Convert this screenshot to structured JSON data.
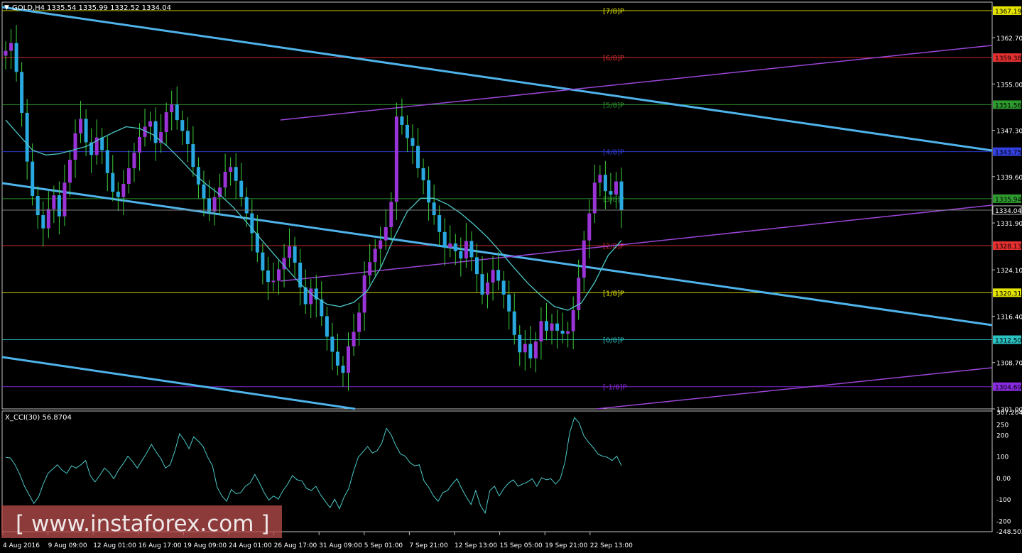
{
  "header": {
    "symbol": "GOLD,H4",
    "ohlc": "1335.54 1335.99 1332.52 1334.04"
  },
  "indicator": {
    "label": "X_CCI(30) 56.8704"
  },
  "watermark": "[ www.instaforex.com ]",
  "colors": {
    "background": "#000000",
    "grid": "#c0c0c0",
    "bull": "#9a34d6",
    "bear": "#2aa9e0",
    "candle_wick": "#3dcf3d",
    "ma": "#4cc7c7",
    "channel": "#4fb3ea",
    "purple_line": "#9b45d8",
    "cci": "#4cc7c7"
  },
  "chart_data": [
    {
      "type": "candlestick",
      "title": "GOLD,H4",
      "ylim": [
        1301.0,
        1368.6
      ],
      "price_ticks": [
        "1362.70",
        "1355.00",
        "1347.30",
        "1339.60",
        "1331.90",
        "1324.10",
        "1316.40",
        "1308.70",
        "1301.00"
      ],
      "time_ticks": [
        "4 Aug 2016",
        "9 Aug 09:00",
        "12 Aug 01:00",
        "16 Aug 17:00",
        "19 Aug 09:00",
        "24 Aug 01:00",
        "26 Aug 17:00",
        "31 Aug 09:00",
        "5 Sep 01:00",
        "7 Sep 21:00",
        "12 Sep 13:00",
        "15 Sep 05:00",
        "19 Sep 21:00",
        "22 Sep 13:00"
      ],
      "current_price": "1334.04",
      "murrey_levels": [
        {
          "label": "[7/8]P",
          "price": 1367.19,
          "price_text": "1367.19",
          "color": "#e4e400"
        },
        {
          "label": "[6/8]P",
          "price": 1359.38,
          "price_text": "1359.38",
          "color": "#e43030"
        },
        {
          "label": "[5/8]P",
          "price": 1351.56,
          "price_text": "1351.56",
          "color": "#2e9b2e"
        },
        {
          "label": "[4/8]P",
          "price": 1343.75,
          "price_text": "1343.75",
          "color": "#3340e0"
        },
        {
          "label": "[3/8]P",
          "price": 1335.94,
          "price_text": "1335.94",
          "color": "#2e9b2e"
        },
        {
          "label": "[2/8]P",
          "price": 1328.13,
          "price_text": "1328.13",
          "color": "#e43030"
        },
        {
          "label": "[1/8]P",
          "price": 1320.31,
          "price_text": "1320.31",
          "color": "#e4e400"
        },
        {
          "label": "[0/8]P",
          "price": 1312.5,
          "price_text": "1312.50",
          "color": "#2bc2c2"
        },
        {
          "label": "[-1/8]P",
          "price": 1304.69,
          "price_text": "1304.69",
          "color": "#8a2be2"
        }
      ],
      "close_series": [
        1360.5,
        1361.8,
        1357.0,
        1350.2,
        1342.1,
        1336.4,
        1333.2,
        1331.0,
        1334.2,
        1336.5,
        1333.0,
        1338.6,
        1342.4,
        1346.8,
        1349.2,
        1345.3,
        1343.2,
        1346.1,
        1344.0,
        1340.2,
        1337.1,
        1336.2,
        1338.4,
        1341.0,
        1343.6,
        1346.2,
        1347.9,
        1348.8,
        1345.2,
        1347.0,
        1350.3,
        1351.6,
        1349.0,
        1347.2,
        1345.0,
        1341.2,
        1338.3,
        1336.0,
        1333.8,
        1336.2,
        1337.8,
        1340.4,
        1341.2,
        1338.9,
        1336.2,
        1333.5,
        1330.2,
        1327.0,
        1324.0,
        1322.1,
        1322.3,
        1324.2,
        1326.1,
        1328.0,
        1325.3,
        1321.2,
        1318.4,
        1321.0,
        1319.2,
        1316.4,
        1313.0,
        1310.5,
        1308.2,
        1307.0,
        1311.4,
        1313.8,
        1317.0,
        1323.2,
        1325.4,
        1327.6,
        1329.0,
        1331.2,
        1335.4,
        1349.6,
        1348.2,
        1346.0,
        1344.7,
        1341.0,
        1339.0,
        1335.3,
        1333.2,
        1330.4,
        1327.8,
        1328.5,
        1327.2,
        1326.0,
        1328.9,
        1326.2,
        1323.4,
        1320.0,
        1322.0,
        1324.1,
        1322.3,
        1320.0,
        1317.2,
        1313.3,
        1310.4,
        1311.8,
        1309.4,
        1312.2,
        1315.6,
        1314.0,
        1315.2,
        1314.0,
        1313.5,
        1313.9,
        1317.4,
        1322.8,
        1329.0,
        1333.5,
        1338.6,
        1339.9,
        1337.2,
        1336.6,
        1338.8,
        1334.04
      ],
      "ma_series": [
        1349.0,
        1346.5,
        1344.0,
        1343.2,
        1343.4,
        1344.0,
        1344.6,
        1345.8,
        1346.9,
        1347.9,
        1347.6,
        1346.6,
        1344.8,
        1342.6,
        1340.2,
        1338.3,
        1336.6,
        1334.5,
        1332.0,
        1329.4,
        1326.8,
        1324.3,
        1321.8,
        1319.8,
        1318.4,
        1318.0,
        1318.7,
        1320.6,
        1324.4,
        1329.4,
        1333.8,
        1336.0,
        1336.0,
        1335.0,
        1333.5,
        1331.6,
        1329.5,
        1327.0,
        1324.4,
        1321.9,
        1319.8,
        1318.0,
        1317.4,
        1318.6,
        1322.0,
        1326.5,
        1329.0
      ],
      "channel_lines": 3,
      "purple_lines": 3
    },
    {
      "type": "line",
      "title": "X_CCI(30) 56.8704",
      "ylim": [
        -248.5033,
        307.2046
      ],
      "y_ticks": [
        "307.2046",
        "250",
        "200",
        "100",
        "0.00",
        "-100",
        "-200",
        "-248.5033"
      ],
      "values": [
        95,
        92,
        60,
        15,
        -40,
        -80,
        -120,
        -90,
        -30,
        20,
        40,
        60,
        35,
        20,
        55,
        45,
        60,
        80,
        10,
        -20,
        10,
        45,
        25,
        -5,
        35,
        65,
        100,
        75,
        45,
        80,
        115,
        155,
        120,
        90,
        45,
        60,
        125,
        205,
        175,
        135,
        190,
        170,
        145,
        95,
        55,
        -45,
        -85,
        -110,
        -55,
        -75,
        -70,
        -40,
        -25,
        15,
        -25,
        -70,
        -105,
        -85,
        -100,
        -60,
        -30,
        10,
        -10,
        -15,
        -50,
        -60,
        -40,
        -80,
        -110,
        -140,
        -100,
        -145,
        -90,
        -50,
        30,
        95,
        120,
        145,
        115,
        125,
        160,
        230,
        200,
        150,
        110,
        100,
        70,
        55,
        60,
        -15,
        -45,
        -85,
        -110,
        -70,
        -60,
        -30,
        -5,
        -50,
        -90,
        -125,
        -60,
        -130,
        -165,
        -60,
        -40,
        -85,
        -50,
        -25,
        -10,
        -40,
        -30,
        -20,
        -5,
        -40,
        0,
        -10,
        -5,
        -30,
        -5,
        75,
        210,
        280,
        255,
        195,
        165,
        140,
        110,
        100,
        95,
        80,
        100,
        56.87
      ]
    }
  ]
}
